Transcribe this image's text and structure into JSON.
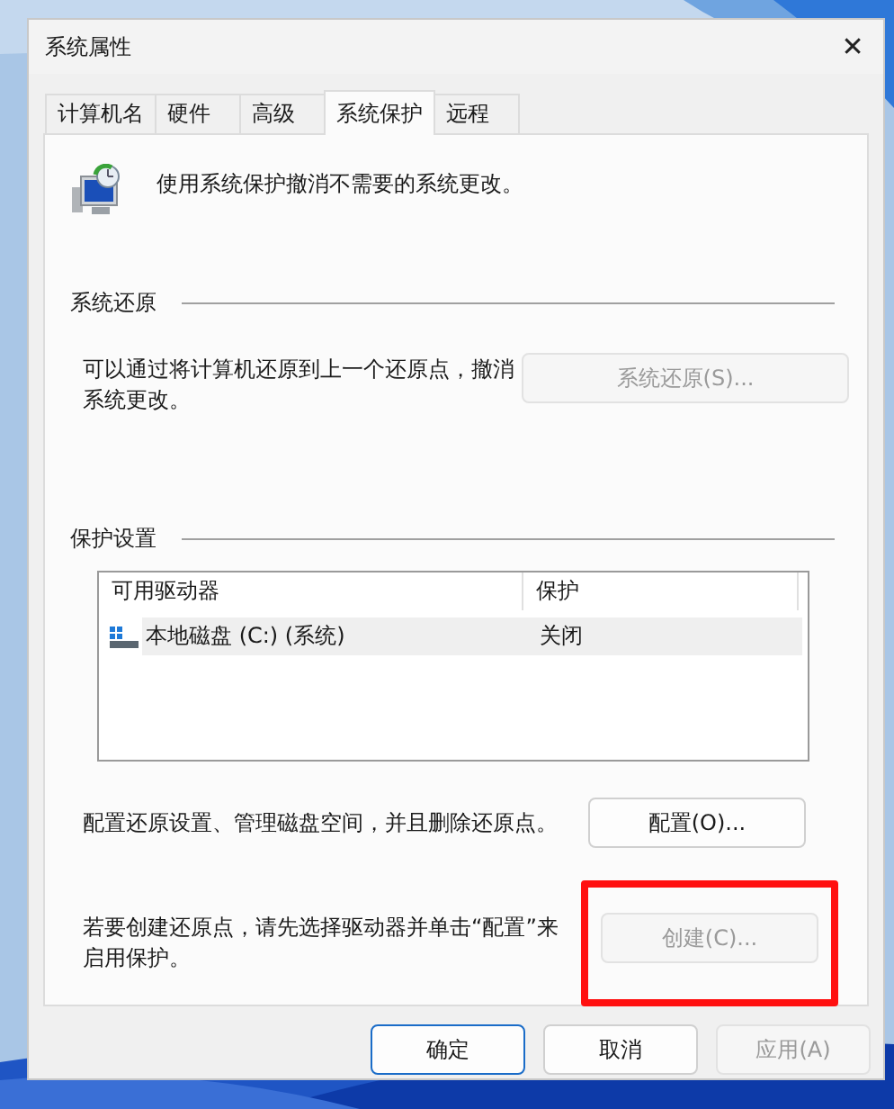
{
  "window": {
    "title": "系统属性",
    "close": "✕"
  },
  "tabs": [
    {
      "label": "计算机名",
      "selected": false
    },
    {
      "label": "硬件",
      "selected": false
    },
    {
      "label": "高级",
      "selected": false
    },
    {
      "label": "系统保护",
      "selected": true
    },
    {
      "label": "远程",
      "selected": false
    }
  ],
  "intro": "使用系统保护撤消不需要的系统更改。",
  "restore_group": {
    "title": "系统还原",
    "text": "可以通过将计算机还原到上一个还原点，撤消系统更改。",
    "button": {
      "label": "系统还原(S)...",
      "disabled": true
    }
  },
  "protection_group": {
    "title": "保护设置",
    "table": {
      "columns": [
        "可用驱动器",
        "保护"
      ],
      "rows": [
        {
          "drive": "本地磁盘 (C:) (系统)",
          "protection": "关闭",
          "selected": true
        }
      ]
    },
    "configure": {
      "text": "配置还原设置、管理磁盘空间，并且删除还原点。",
      "button": {
        "label": "配置(O)...",
        "disabled": false
      }
    },
    "create": {
      "text": "若要创建还原点，请先选择驱动器并单击“配置”来启用保护。",
      "button": {
        "label": "创建(C)...",
        "disabled": true,
        "highlighted": true
      }
    }
  },
  "buttons": [
    {
      "label": "确定",
      "disabled": false,
      "default": true
    },
    {
      "label": "取消",
      "disabled": false,
      "default": false
    },
    {
      "label": "应用(A)",
      "disabled": true,
      "default": false
    }
  ]
}
